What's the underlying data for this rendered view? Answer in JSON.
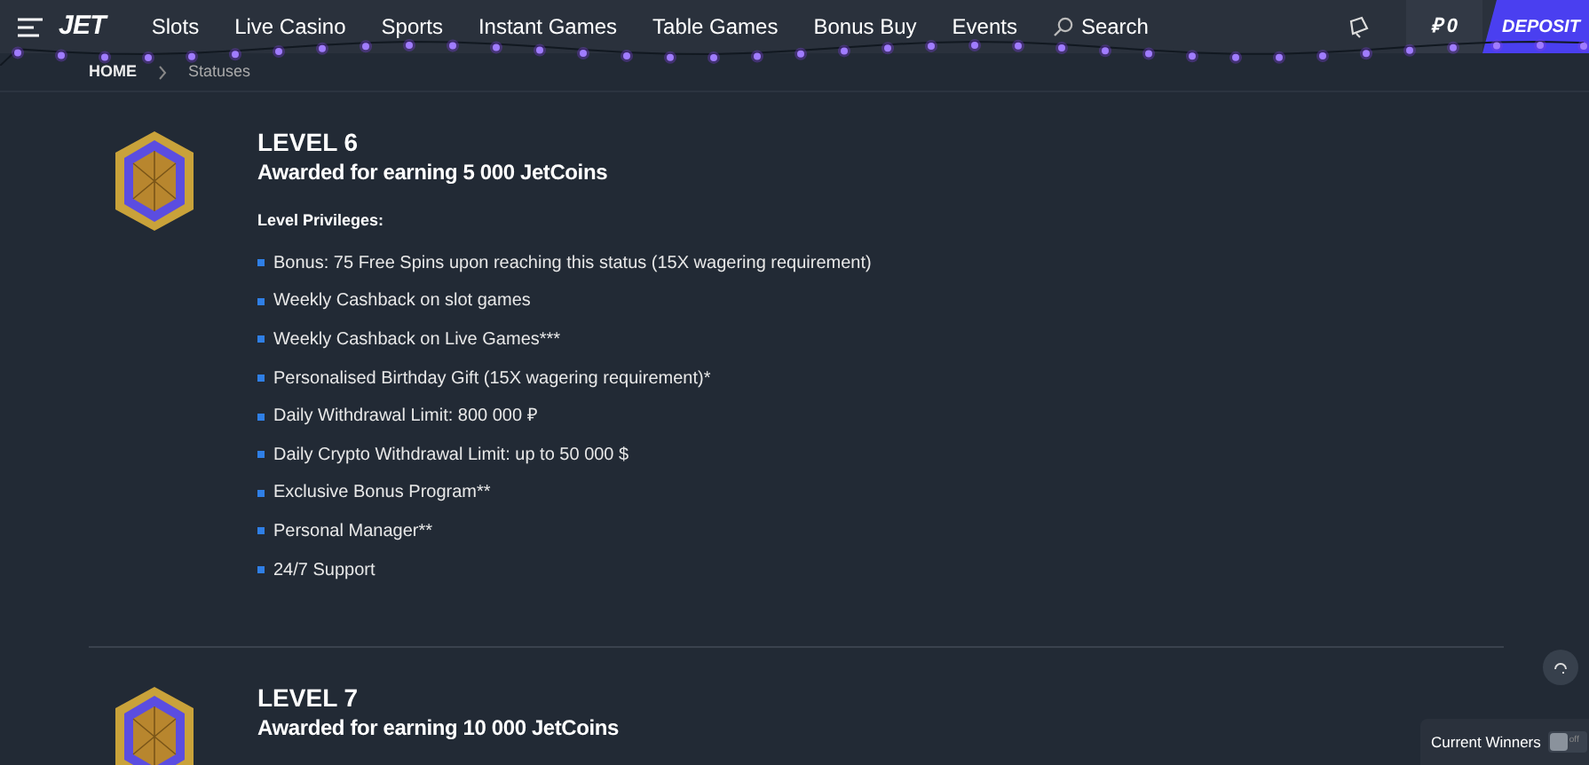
{
  "header": {
    "logo": "JET",
    "nav": [
      {
        "label": "Slots"
      },
      {
        "label": "Live Casino"
      },
      {
        "label": "Sports"
      },
      {
        "label": "Instant Games"
      },
      {
        "label": "Table Games"
      },
      {
        "label": "Bonus Buy"
      },
      {
        "label": "Events"
      }
    ],
    "search": "Search",
    "balance": "₽ 0",
    "deposit": "DEPOSIT"
  },
  "breadcrumb": [
    "HOME",
    "Statuses"
  ],
  "levels": [
    {
      "title": "LEVEL 6",
      "subtitle": "Awarded for earning 5 000 JetCoins",
      "privileges_heading": "Level Privileges:",
      "privileges": [
        "Bonus: 75 Free Spins upon reaching this status (15X wagering requirement)",
        "Weekly Cashback on slot games",
        "Weekly Cashback on Live Games***",
        "Personalised Birthday Gift (15X wagering requirement)*",
        "Daily Withdrawal Limit: 800 000 ₽",
        "Daily Crypto Withdrawal Limit: up to 50 000 $",
        "Exclusive Bonus Program**",
        "Personal Manager**",
        "24/7 Support"
      ]
    },
    {
      "title": "LEVEL 7",
      "subtitle": "Awarded for earning 10 000 JetCoins"
    }
  ],
  "current_winners": {
    "label": "Current Winners",
    "toggle_text": "off",
    "on": false
  }
}
